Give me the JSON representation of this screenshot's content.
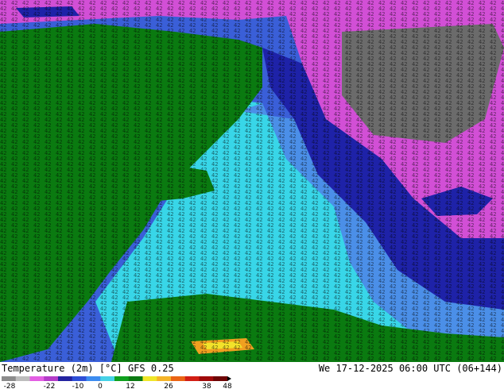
{
  "footer": {
    "title": "Temperature (2m) [°C] GFS 0.25",
    "datetime": "We 17-12-2025 06:00 UTC (06+144)"
  },
  "legend": {
    "ticks": [
      "-28",
      "-22",
      "-10",
      "0",
      "12",
      "26",
      "38",
      "48"
    ],
    "colors": [
      "#8c8c8c",
      "#bdbdbd",
      "#e35ee3",
      "#b43cc8",
      "#2323a0",
      "#2e4fd6",
      "#3c8cf0",
      "#46d2e6",
      "#0fa01e",
      "#0c7a12",
      "#f0e628",
      "#f5b428",
      "#eb6414",
      "#d21e14",
      "#a00a0a",
      "#6e0505"
    ]
  },
  "map": {
    "colors": {
      "ocean_north": "#3a5fd8",
      "ocean_mid": "#4b8fe8",
      "ocean_cyan": "#38d6e8",
      "deep_blue": "#1e22a8",
      "land_green": "#0a7a10",
      "magenta": "#d24fd6",
      "dark_grey": "#6b6b6b",
      "light_green": "#10a61a",
      "orange": "#f0a020",
      "yellow": "#f2e22a"
    }
  }
}
